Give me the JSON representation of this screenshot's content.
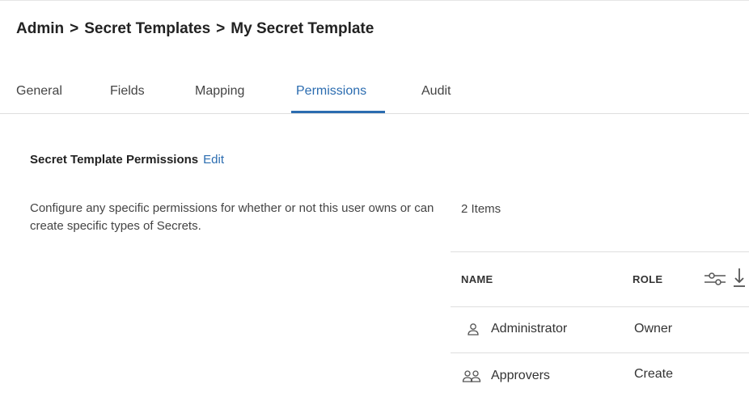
{
  "breadcrumb": {
    "items": [
      "Admin",
      "Secret Templates",
      "My Secret Template"
    ],
    "separator": ">"
  },
  "tabs": [
    {
      "label": "General"
    },
    {
      "label": "Fields"
    },
    {
      "label": "Mapping"
    },
    {
      "label": "Permissions",
      "active": true
    },
    {
      "label": "Audit"
    }
  ],
  "section": {
    "title": "Secret Template Permissions",
    "edit_label": "Edit",
    "description": "Configure any specific permissions for whether or not this user owns or can create specific types of Secrets."
  },
  "table": {
    "count_label": "2 Items",
    "columns": [
      "NAME",
      "ROLE"
    ],
    "rows": [
      {
        "icon": "user-icon",
        "name": "Administrator",
        "role": "Owner"
      },
      {
        "icon": "group-icon",
        "name": "Approvers",
        "role": "Create"
      }
    ],
    "tools": [
      "filter-sliders-icon",
      "download-icon"
    ]
  },
  "colors": {
    "accent": "#2b6cb0",
    "text": "#333333",
    "border": "#dedede"
  }
}
